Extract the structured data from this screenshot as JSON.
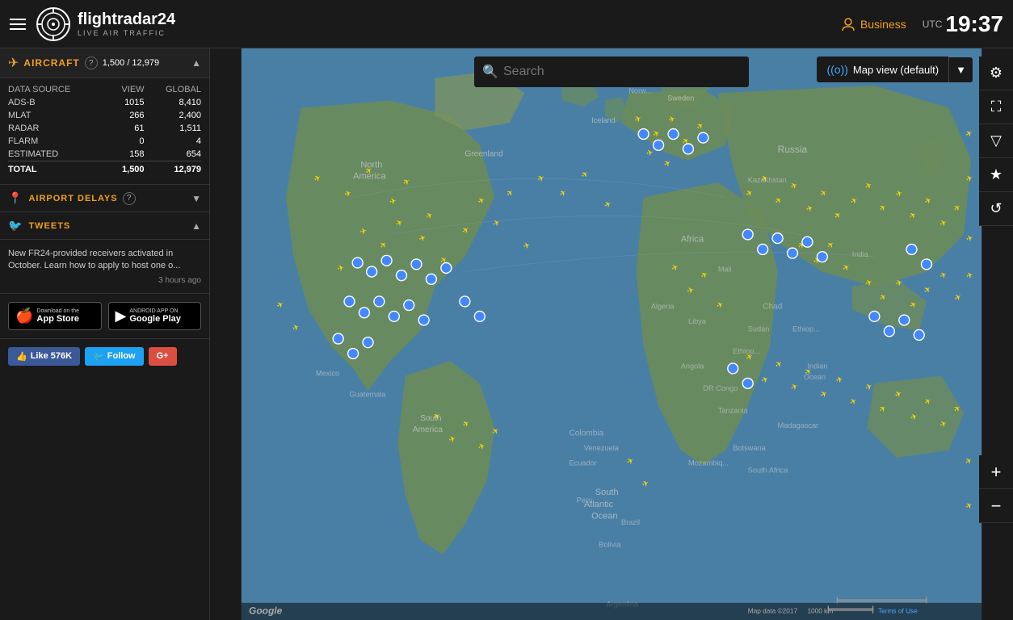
{
  "header": {
    "menu_label": "Menu",
    "logo_brand": "flightradar24",
    "logo_sub": "LIVE AIR TRAFFIC",
    "business_label": "Business",
    "utc_label": "UTC",
    "time": "19:37"
  },
  "sidebar": {
    "aircraft_label": "AIRCRAFT",
    "aircraft_count": "1,500 / 12,979",
    "data_table": {
      "headers": [
        "DATA SOURCE",
        "VIEW",
        "GLOBAL"
      ],
      "rows": [
        {
          "source": "ADS-B",
          "view": "1015",
          "global": "8,410"
        },
        {
          "source": "MLAT",
          "view": "266",
          "global": "2,400"
        },
        {
          "source": "RADAR",
          "view": "61",
          "global": "1,511"
        },
        {
          "source": "FLARM",
          "view": "0",
          "global": "4"
        },
        {
          "source": "ESTIMATED",
          "view": "158",
          "global": "654"
        }
      ],
      "total_row": {
        "source": "TOTAL",
        "view": "1,500",
        "global": "12,979"
      }
    },
    "airport_delays_label": "AIRPORT DELAYS",
    "tweets_label": "TWEETS",
    "tweet": {
      "text": "New FR24-provided receivers activated in October. Learn how to apply to host one o...",
      "time": "3 hours ago"
    },
    "app_store": {
      "ios_small": "Download on the",
      "ios_large": "App Store",
      "android_small": "ANDROID APP ON",
      "android_large": "Google Play"
    },
    "social": {
      "like_label": "Like 576K",
      "follow_label": "Follow",
      "gplus_label": "G+"
    }
  },
  "map": {
    "search_placeholder": "Search",
    "view_label": "Map view (default)",
    "map_data": "Map data ©2017",
    "scale": "1000 km",
    "terms": "Terms of Use"
  },
  "colors": {
    "accent": "#f0a020",
    "plane": "#ffd700",
    "pin": "#4488ff",
    "bg_dark": "#1a1a1a"
  }
}
